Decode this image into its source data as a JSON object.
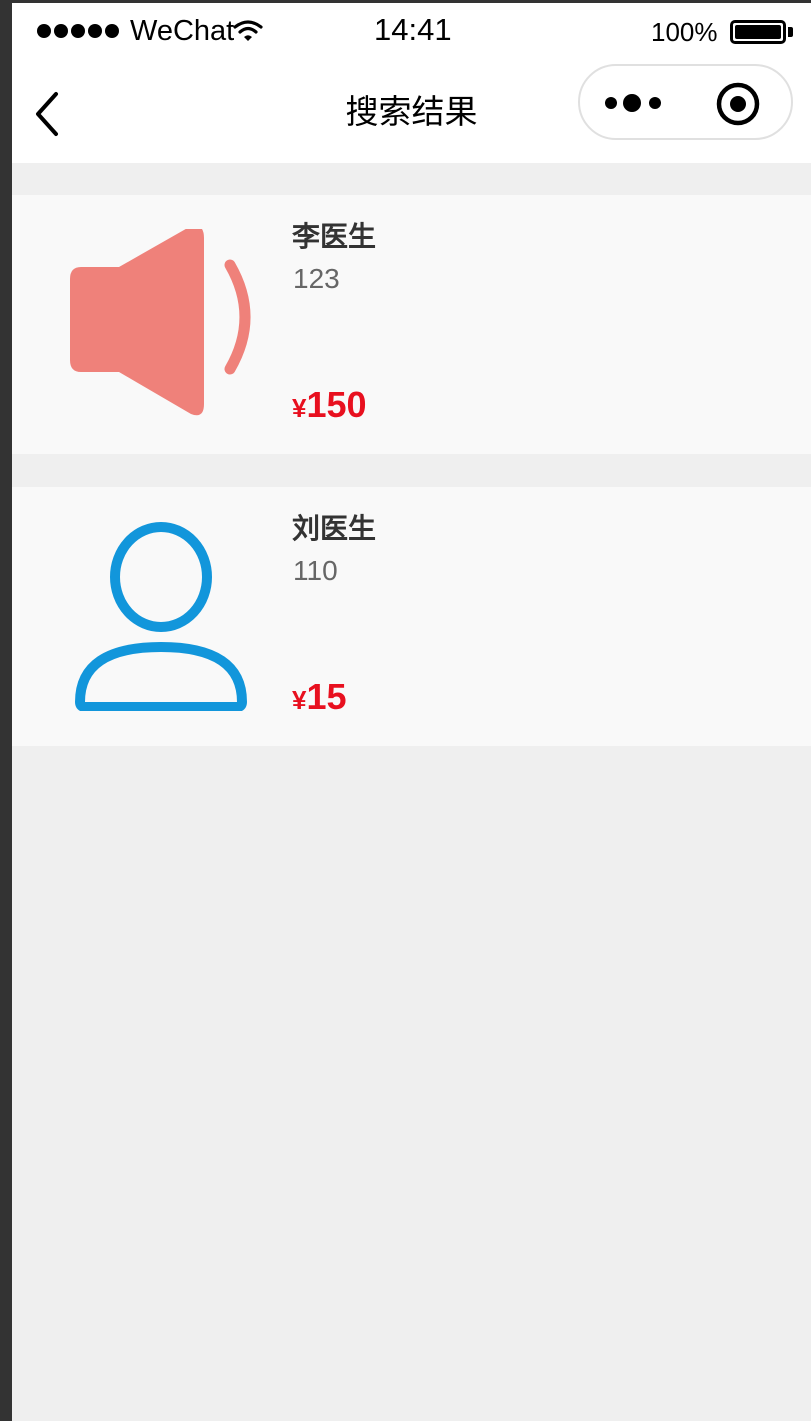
{
  "status_bar": {
    "carrier": "WeChat",
    "time": "14:41",
    "battery": "100%"
  },
  "nav": {
    "title": "搜索结果"
  },
  "results": [
    {
      "name": "李医生",
      "sub": "123",
      "currency": "¥",
      "price": "150",
      "icon": "speaker-icon",
      "icon_color": "#ef817a"
    },
    {
      "name": "刘医生",
      "sub": "110",
      "currency": "¥",
      "price": "15",
      "icon": "user-icon",
      "icon_color": "#1296db"
    }
  ],
  "colors": {
    "price": "#e8101f",
    "page_bg": "#efefef",
    "card_bg": "#f9f9f9"
  }
}
